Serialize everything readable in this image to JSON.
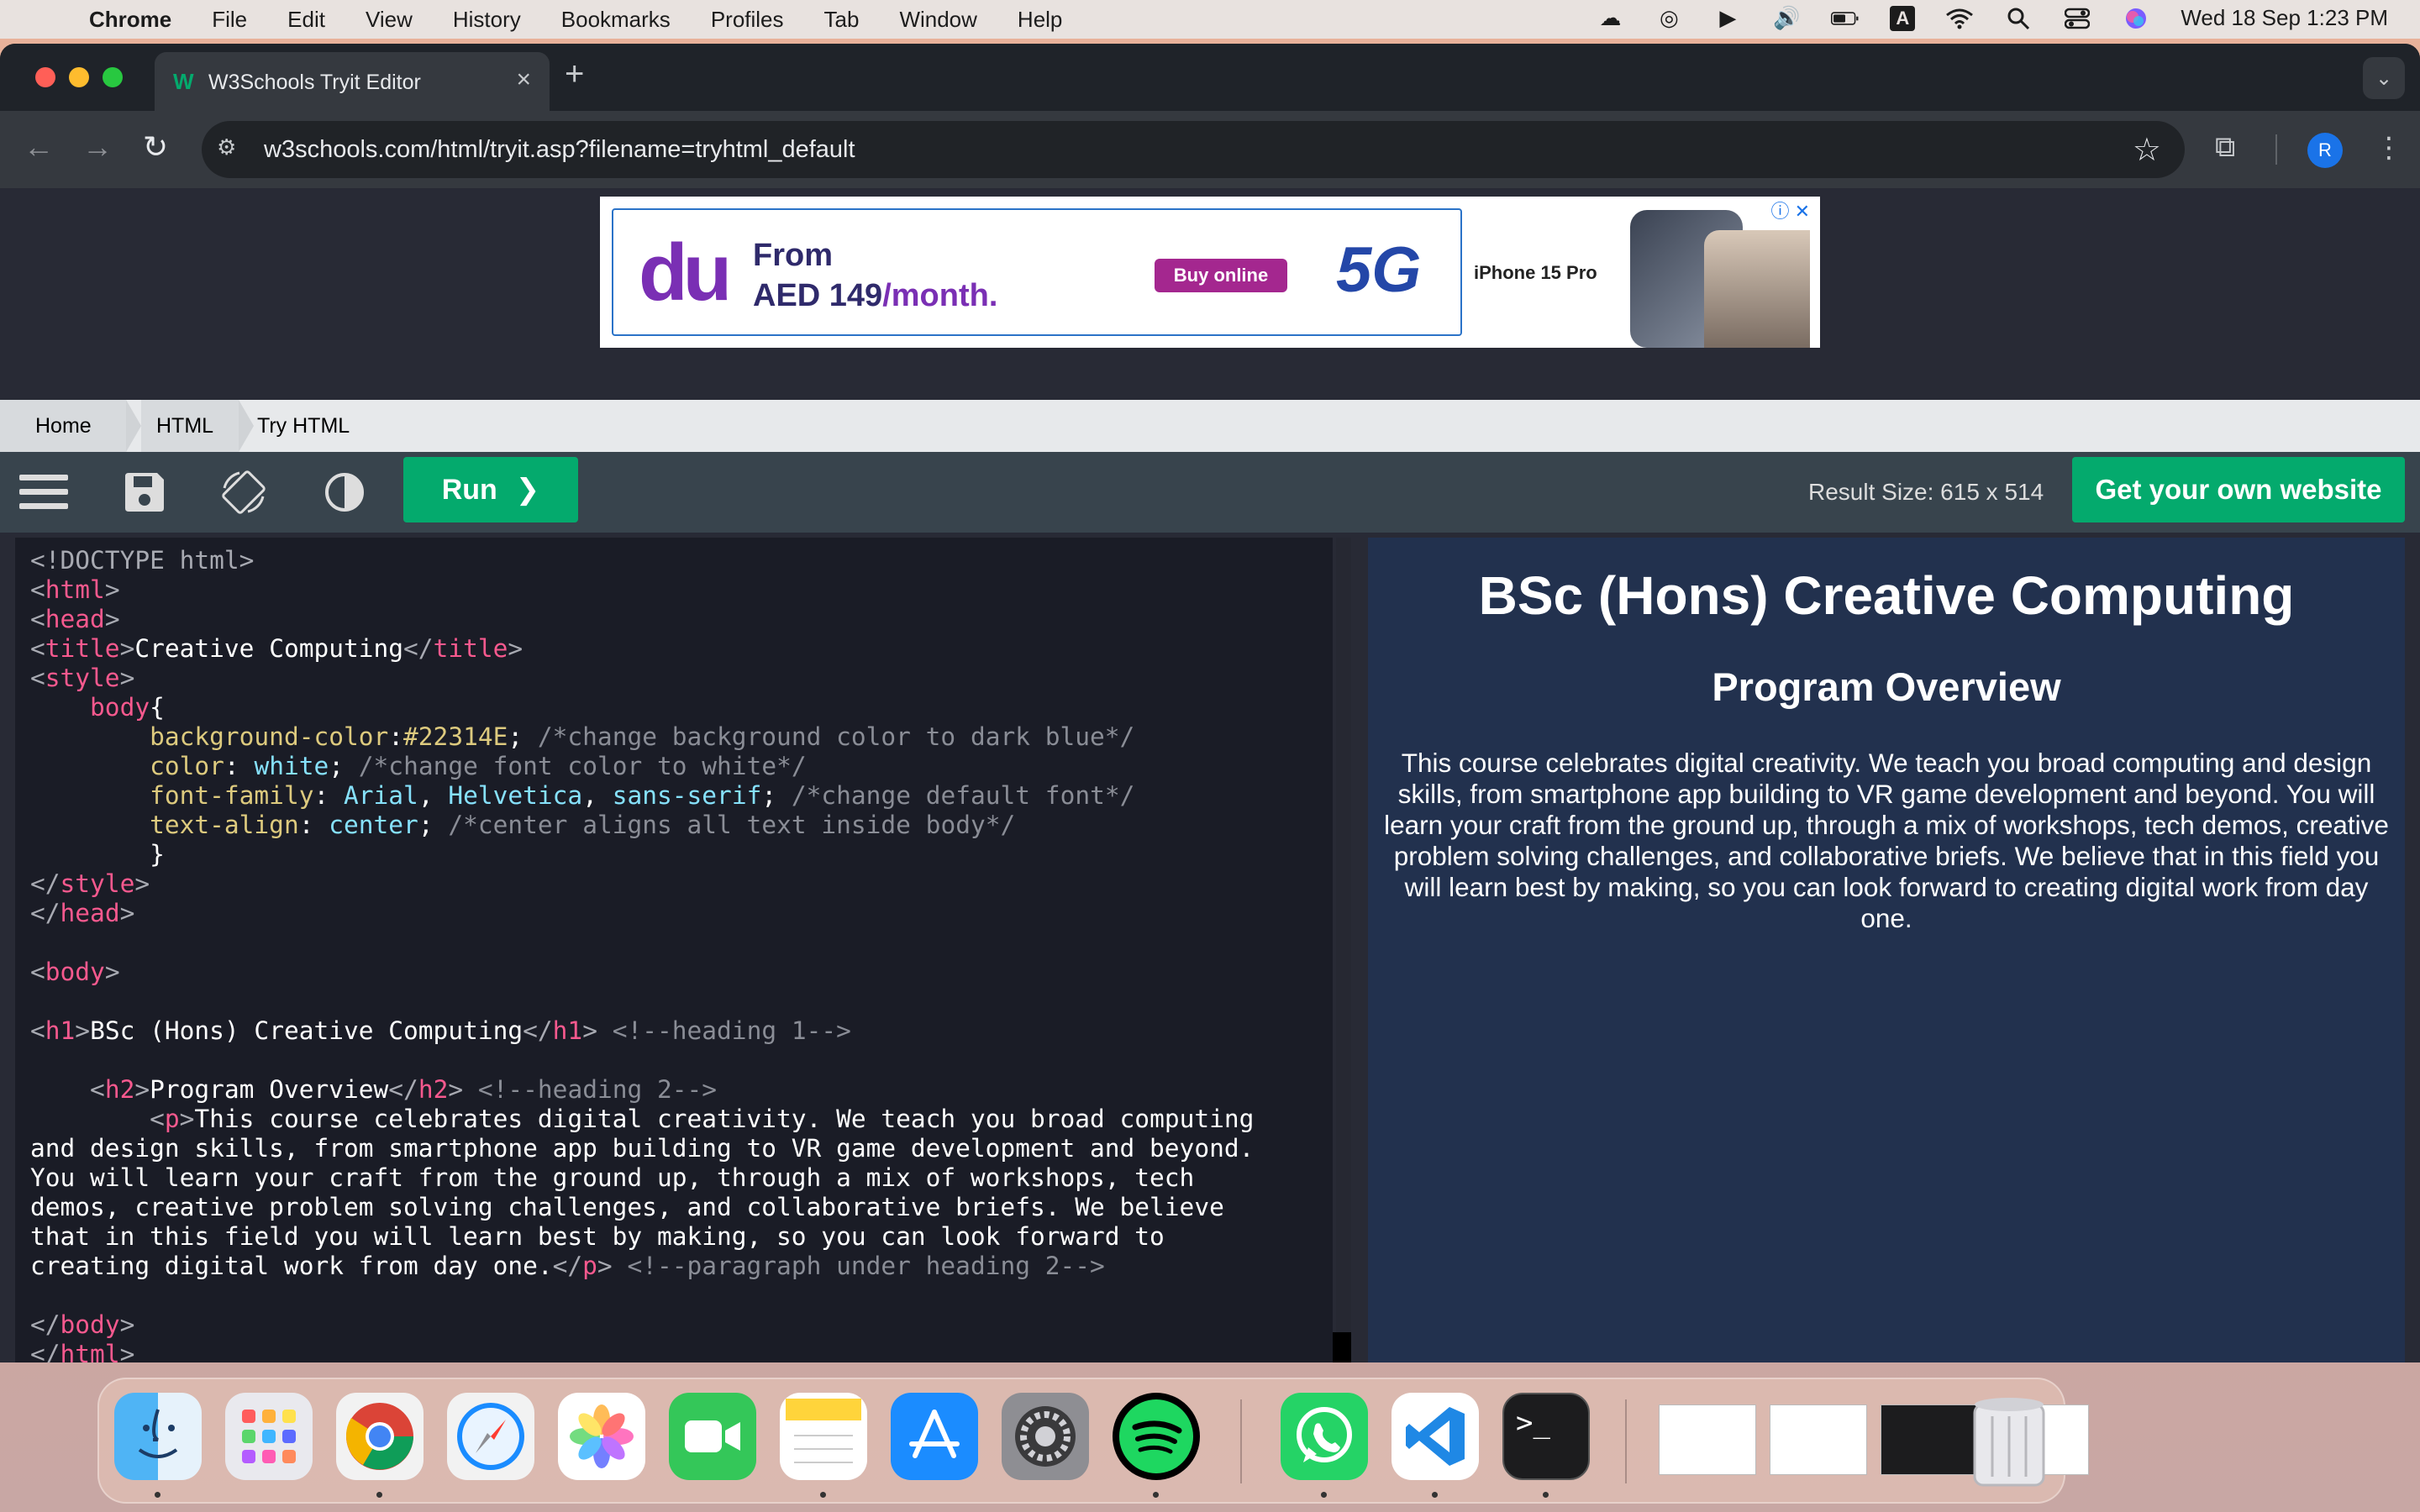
{
  "menubar": {
    "app": "Chrome",
    "items": [
      "File",
      "Edit",
      "View",
      "History",
      "Bookmarks",
      "Profiles",
      "Tab",
      "Window",
      "Help"
    ],
    "input_indicator": "A",
    "datetime": "Wed 18 Sep  1:23 PM"
  },
  "browser": {
    "tab_title": "W3Schools Tryit Editor",
    "url": "w3schools.com/html/tryit.asp?filename=tryhtml_default",
    "profile_initial": "R"
  },
  "ad": {
    "brand": "du",
    "line1": "From",
    "line2_prefix": "AED 149",
    "line2_suffix": "/month.",
    "button": "Buy online",
    "network": "5G",
    "product": "iPhone 15 Pro"
  },
  "breadcrumb": {
    "items": [
      "Home",
      "HTML",
      "Try HTML"
    ]
  },
  "editor": {
    "run_label": "Run",
    "result_size": "Result Size: 615 x 514",
    "get_website_label": "Get your own website",
    "code": {
      "l1": "<!DOCTYPE html>",
      "l2": "html",
      "l3": "head",
      "l4_tag": "title",
      "l4_text": "Creative Computing",
      "l5": "style",
      "l6": "body",
      "l7_prop": "background-color",
      "l7_val": "#22314E",
      "l7_cm": "/*change background color to dark blue*/",
      "l8_prop": "color",
      "l8_val": "white",
      "l8_cm": "/*change font color to white*/",
      "l9_prop": "font-family",
      "l9_val1": "Arial",
      "l9_val2": "Helvetica",
      "l9_val3": "sans-serif",
      "l9_cm": "/*change default font*/",
      "l10_prop": "text-align",
      "l10_val": "center",
      "l10_cm": "/*center aligns all text inside body*/",
      "l11": "}",
      "l14": "body",
      "h1_tag": "h1",
      "h1_text": "BSc (Hons) Creative Computing",
      "h1_cm": "<!--heading 1-->",
      "h2_tag": "h2",
      "h2_text": "Program Overview",
      "h2_cm": "<!--heading 2-->",
      "p_tag": "p",
      "p_line1": "This course celebrates digital creativity. We teach you broad computing",
      "p_line2": "and design skills, from smartphone app building to VR game development and beyond.",
      "p_line3": "You will learn your craft from the ground up, through a mix of workshops, tech",
      "p_line4": "demos, creative problem solving challenges, and collaborative briefs. We believe",
      "p_line5": "that in this field you will learn best by making, so you can look forward to",
      "p_line6": "creating digital work from day one.",
      "p_cm": "<!--paragraph under heading 2-->"
    }
  },
  "result": {
    "h1": "BSc (Hons) Creative Computing",
    "h2": "Program Overview",
    "p": "This course celebrates digital creativity. We teach you broad computing and design skills, from smartphone app building to VR game development and beyond. You will learn your craft from the ground up, through a mix of workshops, tech demos, creative problem solving challenges, and collaborative briefs. We believe that in this field you will learn best by making, so you can look forward to creating digital work from day one."
  },
  "colors": {
    "w3_green": "#04aa6d",
    "result_bg": "#22314E",
    "code_bg": "#1a1c26"
  },
  "dock": {
    "apps": [
      "finder-icon",
      "launchpad-icon",
      "chrome-icon",
      "safari-icon",
      "photos-icon",
      "facetime-icon",
      "notes-icon",
      "app-store-icon",
      "system-settings-icon",
      "spotify-icon",
      "whatsapp-icon",
      "vscode-icon",
      "terminal-icon",
      "trash-icon"
    ]
  }
}
